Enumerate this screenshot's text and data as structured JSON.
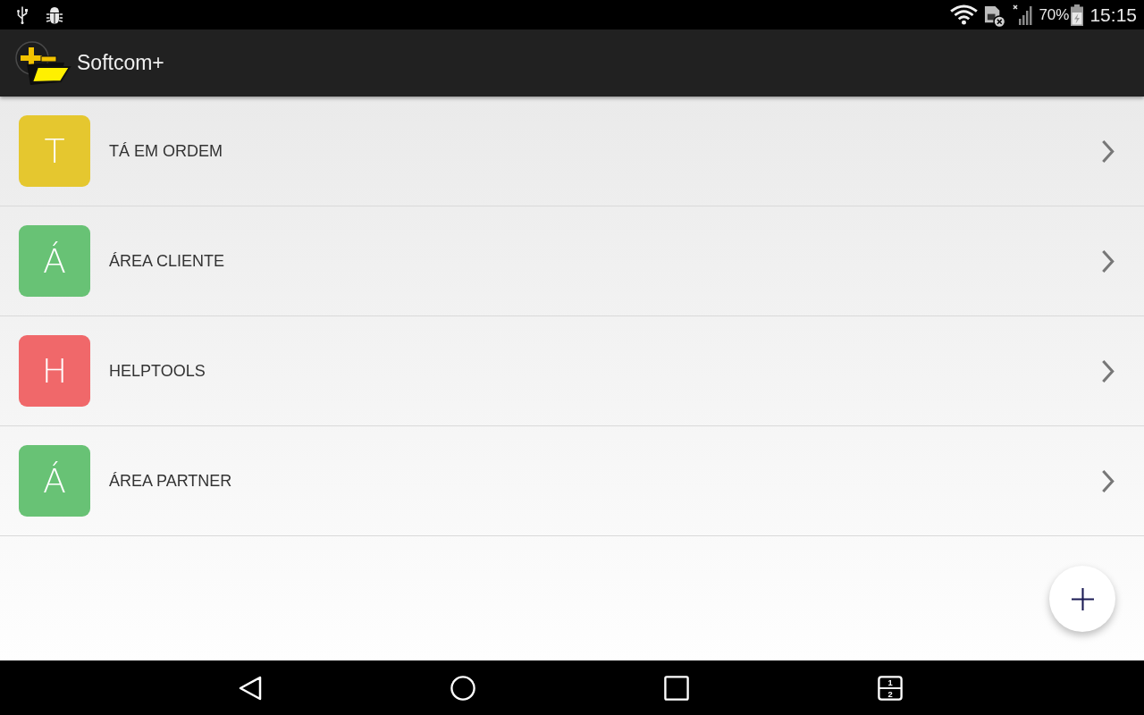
{
  "status_bar": {
    "battery_percent": "70%",
    "time": "15:15"
  },
  "app_bar": {
    "title": "Softcom+"
  },
  "items": [
    {
      "letter": "T",
      "label": "TÁ EM ORDEM",
      "color": "#e5c72f"
    },
    {
      "letter": "Á",
      "label": "ÁREA CLIENTE",
      "color": "#68c275"
    },
    {
      "letter": "H",
      "label": "HELPTOOLS",
      "color": "#f0686a"
    },
    {
      "letter": "Á",
      "label": "ÁREA PARTNER",
      "color": "#68c275"
    }
  ],
  "navigation_bar": {
    "split_screen_icon_digits": [
      "1",
      "2"
    ]
  }
}
